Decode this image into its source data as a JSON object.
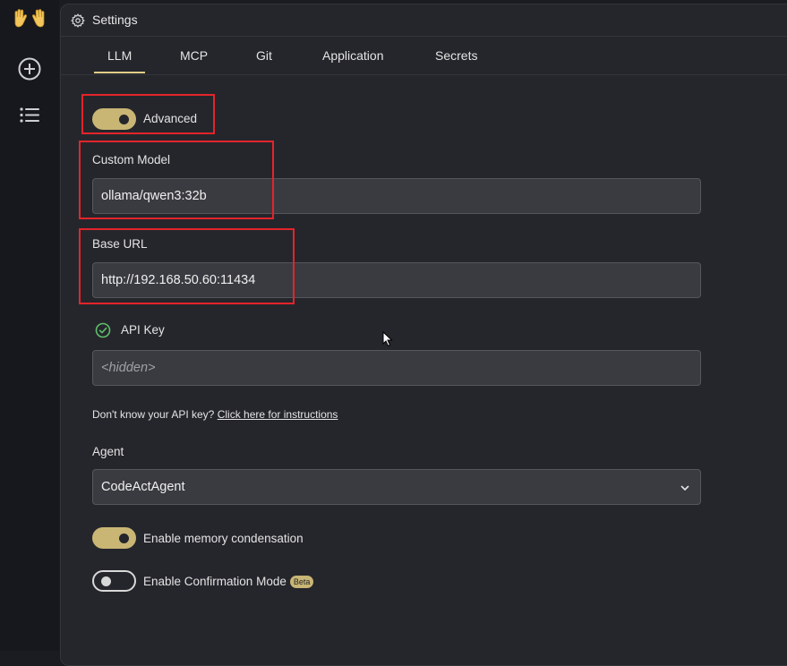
{
  "app": {
    "logo_icon": "raised-hands-icon"
  },
  "sidebar": {
    "icons": [
      "plus-circle-icon",
      "list-icon"
    ]
  },
  "settings": {
    "title": "Settings",
    "title_icon": "gear-icon",
    "tabs": [
      {
        "label": "LLM",
        "active": true
      },
      {
        "label": "MCP",
        "active": false
      },
      {
        "label": "Git",
        "active": false
      },
      {
        "label": "Application",
        "active": false
      },
      {
        "label": "Secrets",
        "active": false
      }
    ],
    "advanced": {
      "label": "Advanced",
      "enabled": true
    },
    "custom_model": {
      "label": "Custom Model",
      "value": "ollama/qwen3:32b"
    },
    "base_url": {
      "label": "Base URL",
      "value": "http://192.168.50.60:11434"
    },
    "api_key": {
      "label": "API Key",
      "placeholder": "<hidden>",
      "status_icon": "check-circle-icon"
    },
    "help": {
      "text": "Don't know your API key?",
      "link": "Click here for instructions"
    },
    "agent": {
      "label": "Agent",
      "value": "CodeActAgent"
    },
    "memory_condensation": {
      "label": "Enable memory condensation",
      "enabled": true
    },
    "confirmation_mode": {
      "label": "Enable Confirmation Mode",
      "badge": "Beta",
      "enabled": false
    }
  },
  "colors": {
    "accent": "#c9b674",
    "highlight": "#e3242b",
    "panel": "#25262c",
    "input": "#3a3b41"
  }
}
